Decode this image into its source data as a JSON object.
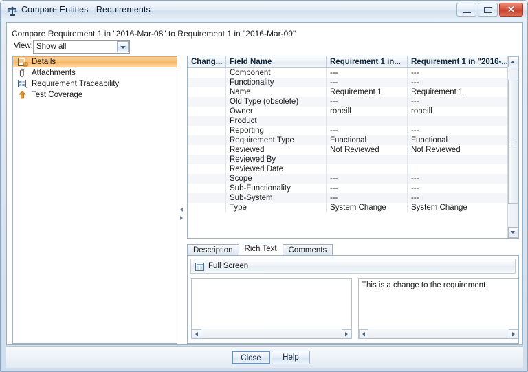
{
  "window": {
    "title": "Compare Entities - Requirements",
    "icon": "balance-scale-icon",
    "minimize_label": "",
    "maximize_label": "",
    "close_label": "✕"
  },
  "caption": "Compare Requirement 1 in \"2016-Mar-08\" to Requirement 1 in \"2016-Mar-09\"",
  "view": {
    "label": "View:",
    "value": "Show all",
    "options": [
      "Show all"
    ]
  },
  "sidebar": {
    "items": [
      {
        "label": "Details",
        "icon": "details-icon",
        "selected": true
      },
      {
        "label": "Attachments",
        "icon": "paperclip-icon",
        "selected": false
      },
      {
        "label": "Requirement Traceability",
        "icon": "traceability-icon",
        "selected": false
      },
      {
        "label": "Test Coverage",
        "icon": "test-coverage-icon",
        "selected": false
      }
    ]
  },
  "table": {
    "columns": [
      "Chang...",
      "Field Name",
      "Requirement 1 in...",
      "Requirement 1 in \"2016-..."
    ],
    "rows": [
      {
        "change": "",
        "field": "Component",
        "left": "---",
        "right": "---"
      },
      {
        "change": "",
        "field": "Functionality",
        "left": "---",
        "right": "---"
      },
      {
        "change": "",
        "field": "Name",
        "left": "Requirement 1",
        "right": "Requirement 1"
      },
      {
        "change": "",
        "field": "Old Type (obsolete)",
        "left": "---",
        "right": "---"
      },
      {
        "change": "",
        "field": "Owner",
        "left": "roneill",
        "right": "roneill"
      },
      {
        "change": "",
        "field": "Product",
        "left": "",
        "right": ""
      },
      {
        "change": "",
        "field": "Reporting",
        "left": "---",
        "right": "---"
      },
      {
        "change": "",
        "field": "Requirement Type",
        "left": "Functional",
        "right": "Functional"
      },
      {
        "change": "",
        "field": "Reviewed",
        "left": "Not Reviewed",
        "right": "Not Reviewed"
      },
      {
        "change": "",
        "field": "Reviewed By",
        "left": "",
        "right": ""
      },
      {
        "change": "",
        "field": "Reviewed Date",
        "left": "",
        "right": ""
      },
      {
        "change": "",
        "field": "Scope",
        "left": "---",
        "right": "---"
      },
      {
        "change": "",
        "field": "Sub-Functionality",
        "left": "---",
        "right": "---"
      },
      {
        "change": "",
        "field": "Sub-System",
        "left": "---",
        "right": "---"
      },
      {
        "change": "",
        "field": "Type",
        "left": "System Change",
        "right": "System Change"
      }
    ]
  },
  "tabs": [
    {
      "label": "Description",
      "active": false
    },
    {
      "label": "Rich Text",
      "active": true
    },
    {
      "label": "Comments",
      "active": false
    }
  ],
  "toolbar": {
    "fullscreen_label": "Full Screen",
    "fullscreen_icon": "fullscreen-icon"
  },
  "panes": {
    "left_text": "",
    "right_text": "This is a change to the requirement"
  },
  "footer": {
    "close_label": "Close",
    "help_label": "Help"
  },
  "colors": {
    "selection": "#f8bd72",
    "close_button": "#c33e27",
    "frame_border": "#8ca7c4"
  }
}
